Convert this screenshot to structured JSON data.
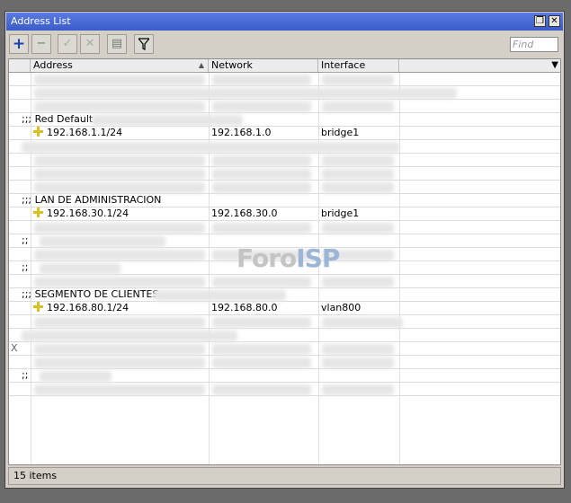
{
  "window": {
    "title": "Address List",
    "restore_glyph": "❐",
    "close_glyph": "✕"
  },
  "toolbar": {
    "add": "+",
    "remove": "−",
    "enable": "✓",
    "disable": "✕",
    "comment": "▤",
    "filter": "⏚",
    "find_placeholder": "Find"
  },
  "columns": {
    "address": "Address",
    "network": "Network",
    "interface": "Interface"
  },
  "rows": {
    "c1": ";;; Red Default",
    "r1": {
      "address": "192.168.1.1/24",
      "network": "192.168.1.0",
      "interface": "bridge1"
    },
    "c2": ";;; LAN DE ADMINISTRACION",
    "r2": {
      "address": "192.168.30.1/24",
      "network": "192.168.30.0",
      "interface": "bridge1"
    },
    "c3": ";;",
    "c4": ";;",
    "c5": ";;; SEGMENTO DE CLIENTES -",
    "r3": {
      "address": "192.168.80.1/24",
      "network": "192.168.80.0",
      "interface": "vlan800"
    },
    "flag_x": "X",
    "c6": ";;"
  },
  "watermark": {
    "a": "Foro",
    "b": "ISP"
  },
  "status": "15 items",
  "colors": {
    "title_bg": "#3a5cc8",
    "plus_icon": "#d8c020"
  }
}
